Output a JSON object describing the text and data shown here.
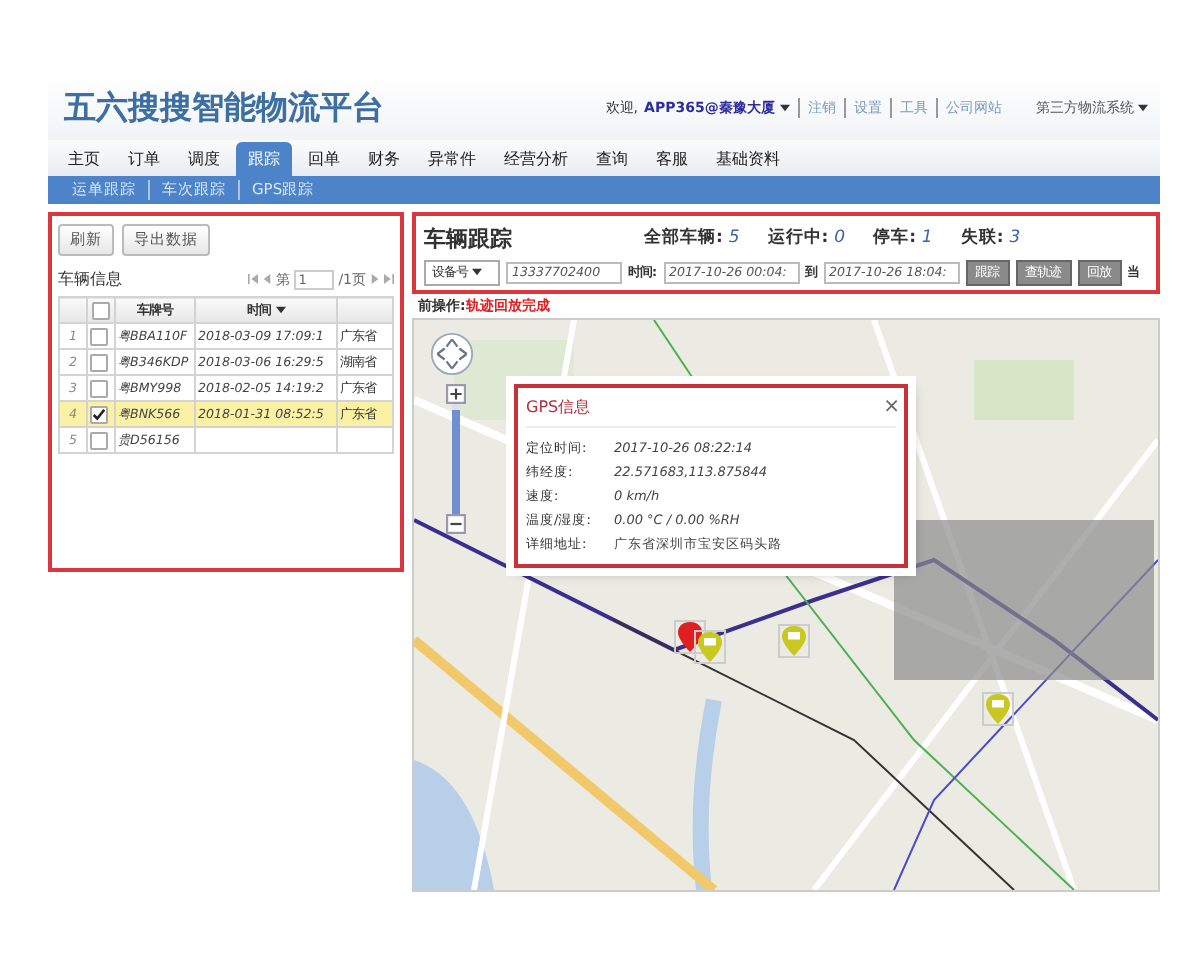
{
  "header": {
    "title": "五六搜搜智能物流平台",
    "welcome": "欢迎,",
    "user": "APP365@秦豫大厦",
    "links": [
      "注销",
      "设置",
      "工具",
      "公司网站"
    ],
    "system_menu": "第三方物流系统"
  },
  "nav": [
    {
      "label": "主页",
      "selected": false
    },
    {
      "label": "订单",
      "selected": false
    },
    {
      "label": "调度",
      "selected": false
    },
    {
      "label": "跟踪",
      "selected": true
    },
    {
      "label": "回单",
      "selected": false
    },
    {
      "label": "财务",
      "selected": false
    },
    {
      "label": "异常件",
      "selected": false
    },
    {
      "label": "经营分析",
      "selected": false
    },
    {
      "label": "查询",
      "selected": false
    },
    {
      "label": "客服",
      "selected": false
    },
    {
      "label": "基础资料",
      "selected": false
    }
  ],
  "subnav": [
    "运单跟踪",
    "车次跟踪",
    "GPS跟踪"
  ],
  "vehicle_list": {
    "all_checked": false,
    "buttons": [
      "刷新",
      "导出数据"
    ],
    "title": "车辆信息",
    "pager": {
      "prefix": "第",
      "page": "1",
      "suffix": "/1页"
    },
    "columns": [
      "车牌号",
      "时间"
    ],
    "rows": [
      {
        "index": "1",
        "plate": "粤BBA110F",
        "time": "2018-03-09 17:09:1",
        "place": "广东省",
        "checked": false,
        "selected": false
      },
      {
        "index": "2",
        "plate": "粤B346KDP",
        "time": "2018-03-06 16:29:5",
        "place": "湖南省",
        "checked": false,
        "selected": false
      },
      {
        "index": "3",
        "plate": "粤BMY998",
        "time": "2018-02-05 14:19:2",
        "place": "广东省",
        "checked": false,
        "selected": false
      },
      {
        "index": "4",
        "plate": "粤BNK566",
        "time": "2018-01-31 08:52:5",
        "place": "广东省",
        "checked": true,
        "selected": true
      },
      {
        "index": "5",
        "plate": "贵D56156",
        "time": "",
        "place": "",
        "checked": false,
        "selected": false
      }
    ]
  },
  "tracking": {
    "title": "车辆跟踪",
    "stats": [
      {
        "label": "全部车辆:",
        "value": "5"
      },
      {
        "label": "运行中:",
        "value": "0"
      },
      {
        "label": "停车:",
        "value": "1"
      },
      {
        "label": "失联:",
        "value": "3"
      }
    ],
    "device_select": "设备号",
    "device_value": "13337702400",
    "time_label": "时间:",
    "time_from": "2017-10-26 00:04:",
    "to_label": "到",
    "time_to": "2017-10-26 18:04:",
    "buttons": [
      "跟踪",
      "查轨迹",
      "回放"
    ],
    "trailing": "当",
    "status_label": "前操作:",
    "status_text": "轨迹回放完成"
  },
  "map_zoom": {
    "level": 0.95
  },
  "gps_popup": {
    "title": "GPS信息",
    "close": "×",
    "rows": [
      {
        "label": "定位时间:",
        "value": "2017-10-26 08:22:14"
      },
      {
        "label": "纬经度:",
        "value": "22.571683,113.875844"
      },
      {
        "label": "速度:",
        "value": "0 km/h"
      },
      {
        "label": "温度/湿度:",
        "value": "0.00 °C / 0.00 %RH"
      },
      {
        "label": "详细地址:",
        "value": "广东省深圳市宝安区码头路"
      }
    ]
  }
}
